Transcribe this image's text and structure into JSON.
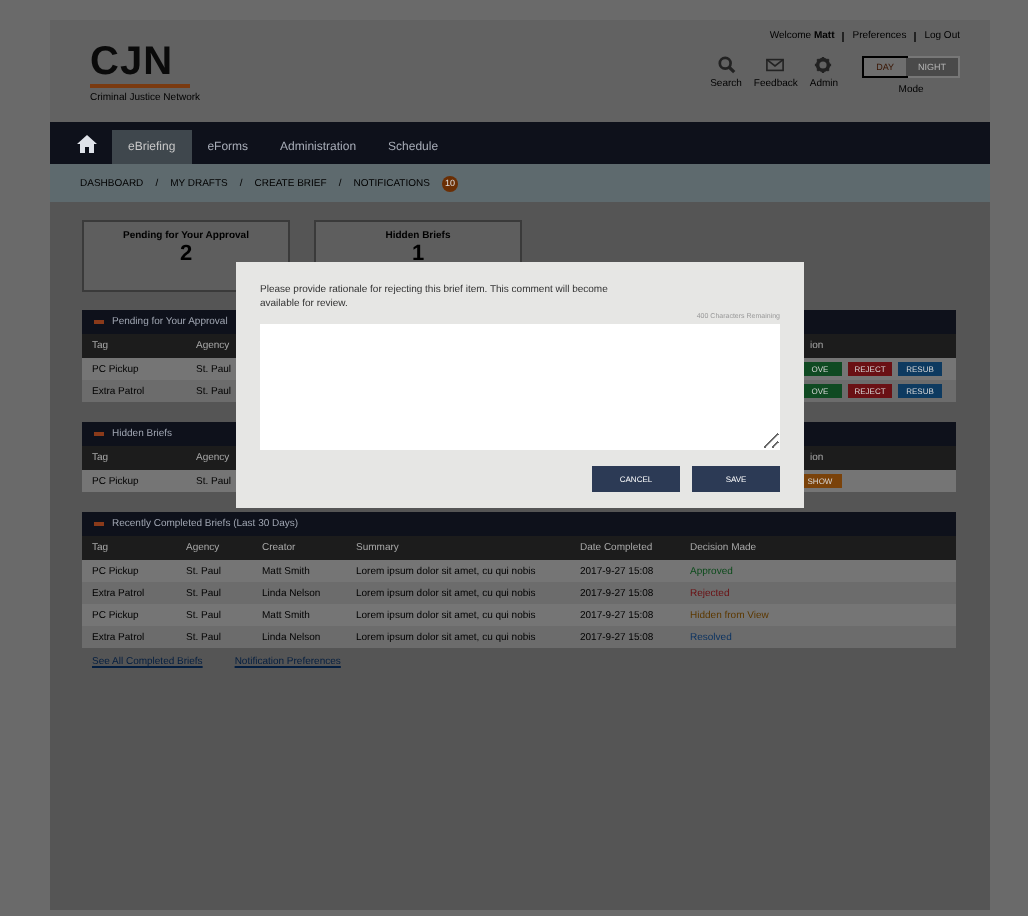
{
  "header": {
    "logo": "CJN",
    "tagline": "Criminal Justice Network",
    "welcome": "Welcome",
    "user": "Matt",
    "links": [
      "Preferences",
      "Log Out"
    ],
    "tools": [
      {
        "kind": "search",
        "label": "Search"
      },
      {
        "kind": "mail",
        "label": "Feedback"
      },
      {
        "kind": "gear",
        "label": "Admin"
      }
    ],
    "mode": {
      "label": "Mode",
      "options": [
        {
          "label": "DAY",
          "selected": true
        },
        {
          "label": "NIGHT",
          "selected": false
        }
      ]
    }
  },
  "nav": {
    "tabs": [
      {
        "label": "eBriefing",
        "selected": true
      },
      {
        "label": "eForms",
        "selected": false
      },
      {
        "label": "Administration",
        "selected": false
      },
      {
        "label": "Schedule",
        "selected": false
      }
    ]
  },
  "breadcrumb": {
    "items": [
      "DASHBOARD",
      "MY DRAFTS",
      "CREATE BRIEF",
      "NOTIFICATIONS"
    ],
    "separator": "/",
    "badge": "10"
  },
  "stats": [
    {
      "label": "Pending for Your Approval",
      "value": "2"
    },
    {
      "label": "Hidden Briefs",
      "value": "1"
    }
  ],
  "pending": {
    "title": "Pending for Your Approval",
    "columns": [
      "Tag",
      "Agency",
      "ion"
    ],
    "rows": [
      {
        "tag": "PC Pickup",
        "agency": "St. Paul",
        "actions": [
          {
            "kind": "approve",
            "label": "OVE"
          },
          {
            "kind": "reject",
            "label": "REJECT"
          },
          {
            "kind": "resubmit",
            "label": "RESUB"
          }
        ]
      },
      {
        "tag": "Extra Patrol",
        "agency": "St. Paul",
        "actions": [
          {
            "kind": "approve",
            "label": "OVE"
          },
          {
            "kind": "reject",
            "label": "REJECT"
          },
          {
            "kind": "resubmit",
            "label": "RESUB"
          }
        ]
      }
    ]
  },
  "hidden": {
    "title": "Hidden Briefs",
    "columns": [
      "Tag",
      "Agency",
      "ion"
    ],
    "rows": [
      {
        "tag": "PC Pickup",
        "agency": "St. Paul",
        "actions": [
          {
            "kind": "unhide",
            "label": "SHOW"
          }
        ]
      }
    ]
  },
  "completed": {
    "title": "Recently Completed Briefs (Last 30 Days)",
    "columns": [
      "Tag",
      "Agency",
      "Creator",
      "Summary",
      "Date Completed",
      "Decision Made"
    ],
    "rows": [
      {
        "tag": "PC Pickup",
        "agency": "St. Paul",
        "creator": "Matt Smith",
        "summary": "Lorem ipsum dolor sit amet, cu qui nobis",
        "date": "2017-9-27 15:08",
        "decision": "Approved",
        "color": "#0b4a1a"
      },
      {
        "tag": "Extra Patrol",
        "agency": "St. Paul",
        "creator": "Linda Nelson",
        "summary": "Lorem ipsum dolor sit amet, cu qui nobis",
        "date": "2017-9-27 15:08",
        "decision": "Rejected",
        "color": "#6a0f12"
      },
      {
        "tag": "PC Pickup",
        "agency": "St. Paul",
        "creator": "Matt Smith",
        "summary": "Lorem ipsum dolor sit amet, cu qui nobis",
        "date": "2017-9-27 15:08",
        "decision": "Hidden from View",
        "color": "#5c3800"
      },
      {
        "tag": "Extra Patrol",
        "agency": "St. Paul",
        "creator": "Linda Nelson",
        "summary": "Lorem ipsum dolor sit amet, cu qui nobis",
        "date": "2017-9-27 15:08",
        "decision": "Resolved",
        "color": "#0c3361"
      }
    ],
    "links": [
      "See All Completed Briefs",
      "Notification Preferences"
    ]
  },
  "modal": {
    "message": "Please provide rationale for rejecting this brief item. This comment will become available for review.",
    "counter": "400 Characters Remaining",
    "buttons": [
      "CANCEL",
      "SAVE"
    ]
  }
}
